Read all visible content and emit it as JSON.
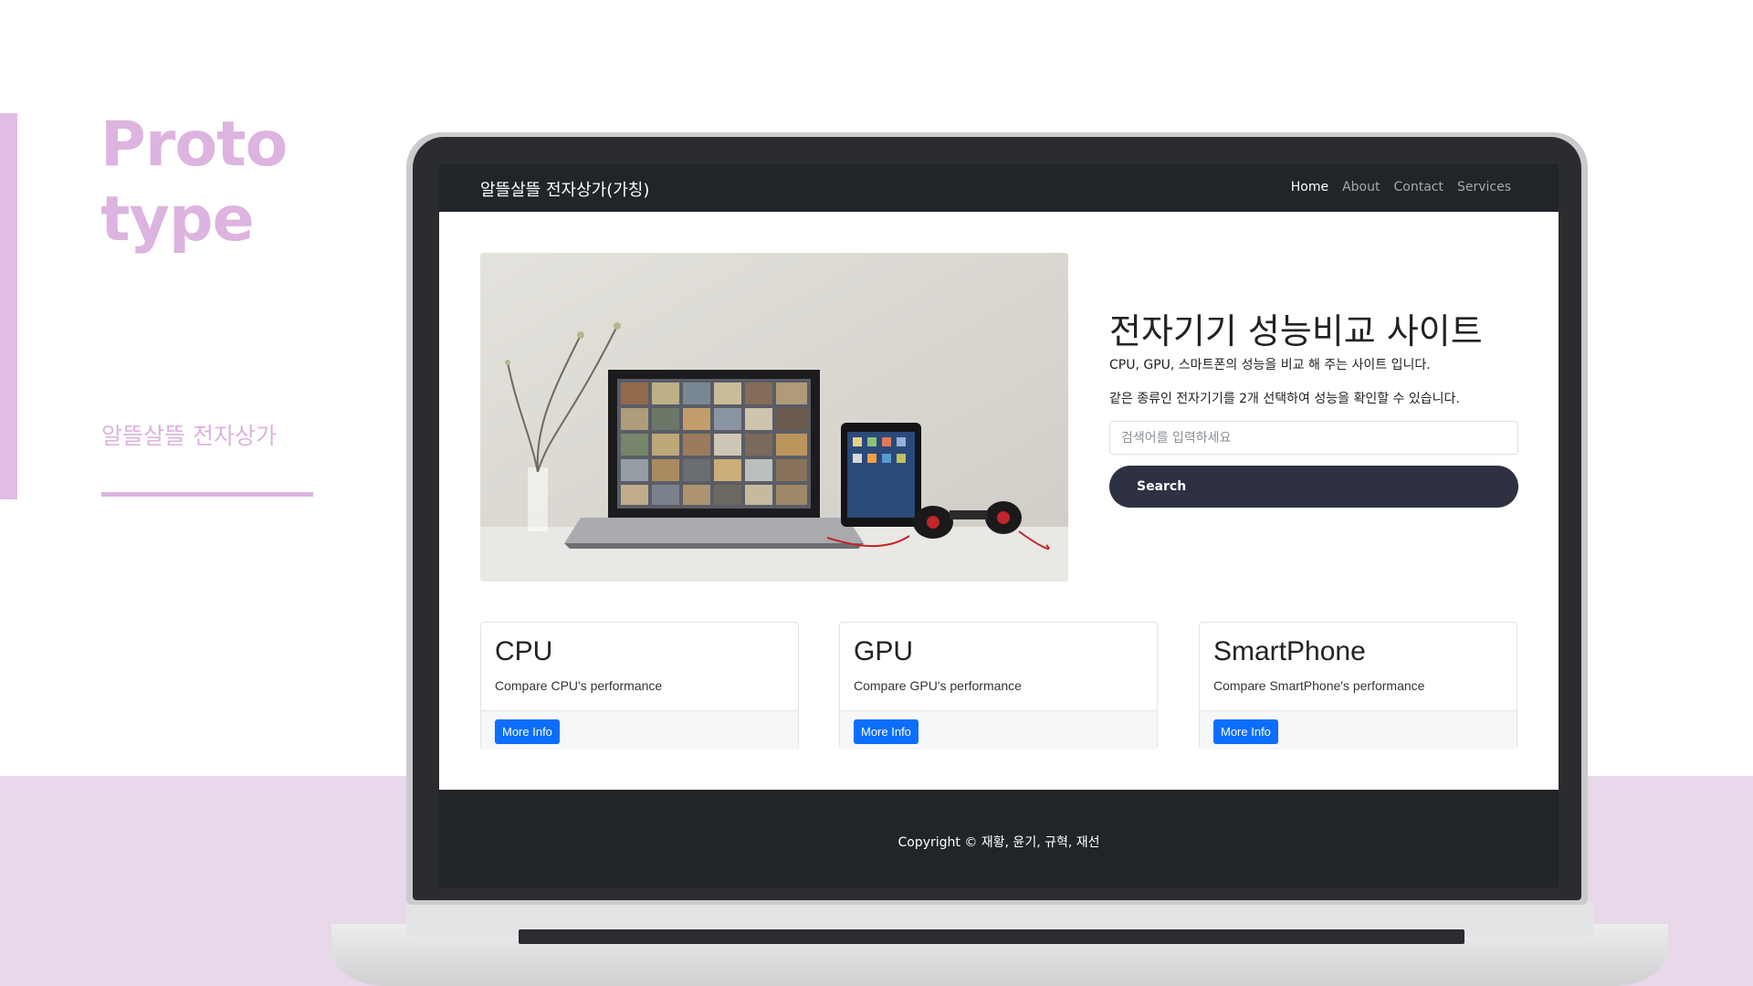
{
  "slide": {
    "heading_line1": "Proto",
    "heading_line2": "type",
    "subtitle": "알뜰살뜰 전자상가",
    "accent_color": "#dcb4df"
  },
  "nav": {
    "brand": "알뜰살뜰 전자상가(가칭)",
    "links": [
      "Home",
      "About",
      "Contact",
      "Services"
    ]
  },
  "hero": {
    "title": "전자기기 성능비교 사이트",
    "desc1": "CPU, GPU, 스마트폰의 성능을 비교 해 주는 사이트 입니다.",
    "desc2": "같은 종류인 전자기기를 2개 선택하여 성능을 확인할 수 있습니다.",
    "search_placeholder": "검색어를 입력하세요",
    "search_button": "Search"
  },
  "cards": [
    {
      "title": "CPU",
      "text": "Compare CPU's performance",
      "button": "More Info"
    },
    {
      "title": "GPU",
      "text": "Compare GPU's performance",
      "button": "More Info"
    },
    {
      "title": "SmartPhone",
      "text": "Compare SmartPhone's performance",
      "button": "More Info"
    }
  ],
  "footer": {
    "copyright": "Copyright © 재황, 윤기, 규혁, 재선"
  },
  "colors": {
    "navbar": "#212529",
    "primary_button": "#0d6efd",
    "search_button": "#2d3142"
  }
}
